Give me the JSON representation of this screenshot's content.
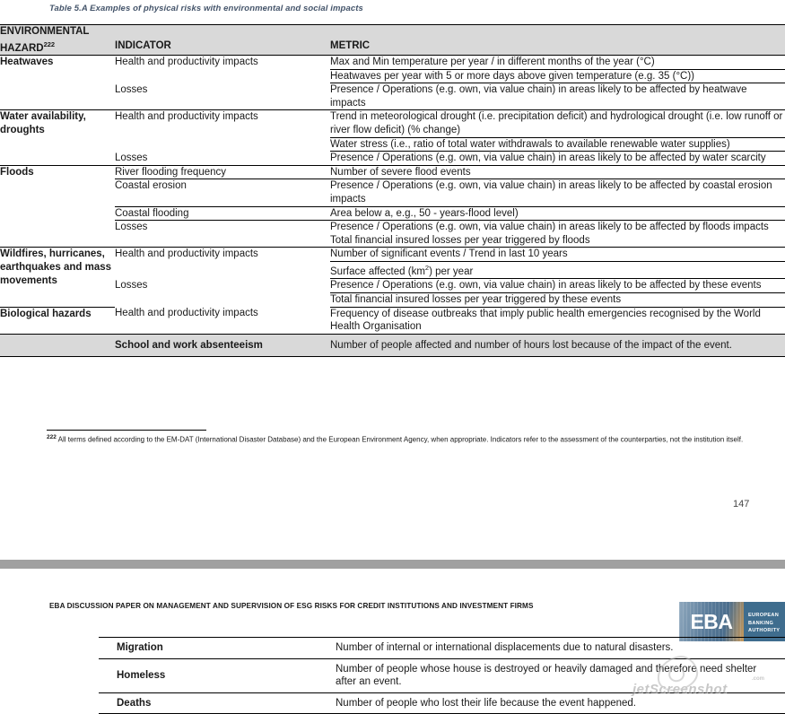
{
  "page1": {
    "caption": "Table 5.A Examples of physical risks with environmental and social impacts",
    "headers": {
      "hazard": "ENVIRONMENTAL HAZARD",
      "hazard_footnote_marker": "222",
      "indicator": "INDICATOR",
      "metric": "METRIC"
    },
    "rows": [
      {
        "hazard": "Heatwaves",
        "indicators": [
          {
            "label": "Health and productivity impacts",
            "metrics": [
              "Max and Min temperature  per year / in different months of the year (°C)",
              "Heatwaves per year with 5 or more days above given temperature (e.g. 35 (°C))"
            ]
          },
          {
            "label": "Losses",
            "metrics": [
              "Presence / Operations (e.g. own, via value chain) in areas likely to be affected by heatwave impacts"
            ]
          }
        ]
      },
      {
        "hazard": "Water availability, droughts",
        "indicators": [
          {
            "label": "Health and productivity impacts",
            "metrics": [
              "Trend in meteorological drought (i.e. precipitation deficit) and hydrological drought (i.e. low runoff or river flow deficit) (% change)",
              "Water stress (i.e., ratio of total water withdrawals to available renewable water supplies)"
            ]
          },
          {
            "label": "Losses",
            "metrics": [
              "Presence / Operations (e.g. own, via value chain) in areas likely to be affected by water scarcity"
            ]
          }
        ]
      },
      {
        "hazard": "Floods",
        "indicators": [
          {
            "label": "River flooding frequency",
            "metrics": [
              "Number of severe flood events"
            ]
          },
          {
            "label": "Coastal erosion",
            "metrics": [
              "Presence / Operations (e.g. own, via value chain) in areas likely to be affected by coastal erosion impacts"
            ]
          },
          {
            "label": "Coastal flooding",
            "metrics": [
              "Area below a, e.g., 50 - years-flood level)"
            ]
          },
          {
            "label": "Losses",
            "metrics": [
              "Presence / Operations (e.g. own, via value chain) in areas likely to be affected by floods impacts",
              "Total financial insured losses per year triggered by floods"
            ],
            "metrics_joined": true
          }
        ]
      },
      {
        "hazard": "Wildfires, hurricanes, earthquakes and mass movements",
        "indicators": [
          {
            "label": "Health and productivity impacts",
            "metrics": [
              "Number of significant events / Trend in last 10 years",
              "Surface affected (km2) per year"
            ]
          },
          {
            "label": "Losses",
            "metrics": [
              "Presence / Operations (e.g. own, via value chain) in areas likely to be affected by these events",
              "Total financial insured losses per year triggered by these events"
            ]
          }
        ]
      },
      {
        "hazard": "Biological hazards",
        "indicators": [
          {
            "label": "Health and productivity impacts",
            "metrics": [
              "Frequency of disease outbreaks that imply public health emergencies recognised by the World Health Organisation"
            ]
          }
        ]
      }
    ],
    "gray_row": {
      "hazard": "",
      "indicator": "School and work absenteeism",
      "metric": "Number of people affected and number of hours lost because of the impact of the event."
    },
    "footnote": {
      "marker": "222",
      "text": " All terms defined according to the EM-DAT (International Disaster Database) and the European Environment Agency, when appropriate. Indicators refer to the assessment of the counterparties, not the institution itself."
    },
    "page_number": "147"
  },
  "page2": {
    "running_header": "EBA DISCUSSION PAPER ON MANAGEMENT AND SUPERVISION OF ESG RISKS FOR CREDIT INSTITUTIONS AND INVESTMENT FIRMS",
    "logo": {
      "acronym": "EBA",
      "line1": "EUROPEAN",
      "line2": "BANKING",
      "line3": "AUTHORITY"
    },
    "rows": [
      {
        "indicator": "Migration",
        "metric": "Number of internal or international displacements due to natural disasters."
      },
      {
        "indicator": "Homeless",
        "metric": "Number of people whose house is destroyed or heavily damaged and therefore need shelter after an event."
      },
      {
        "indicator": "Deaths",
        "metric": "Number of people who lost their life because the event happened."
      }
    ]
  },
  "watermark": {
    "text": "jetScreenshot",
    "suffix": ".com"
  },
  "colors": {
    "caption": "#44546a",
    "header_bg": "#d9d9d9",
    "logo_blue": "#3f6d8e",
    "page_gap": "#a0a0a0"
  }
}
